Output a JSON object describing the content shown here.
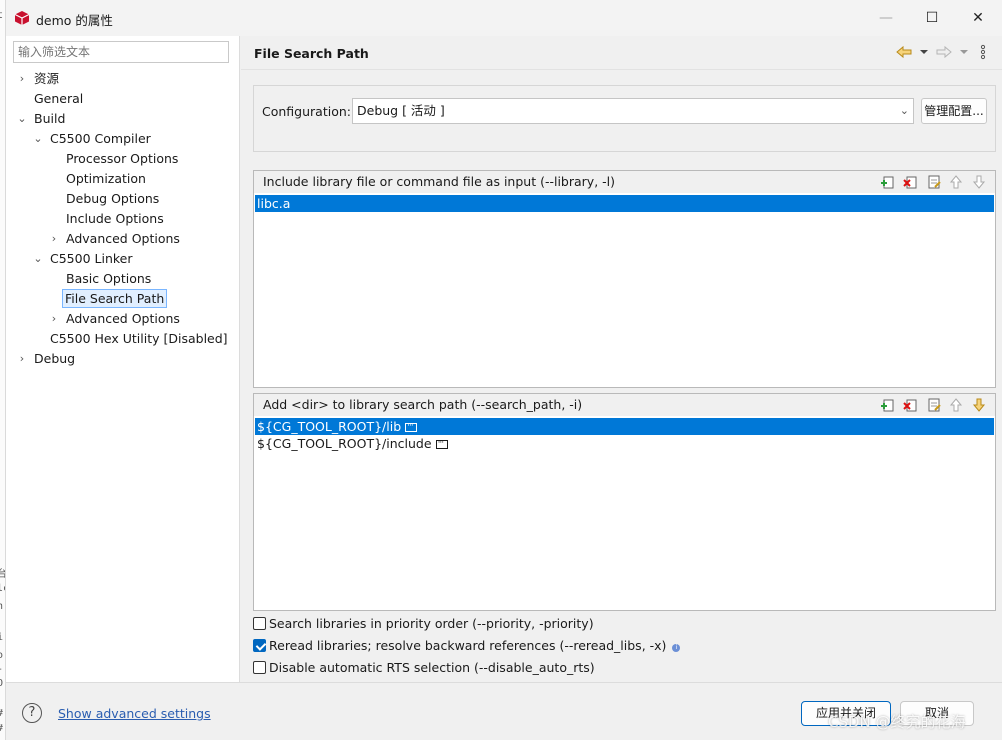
{
  "window": {
    "title": "demo 的属性",
    "minimize": "—",
    "maximize": "☐",
    "close": "✕",
    "background_strip": [
      "t",
      "台",
      "lc",
      "n",
      "i",
      "o",
      "-",
      "O",
      "#",
      "#"
    ]
  },
  "sidebar": {
    "filter_placeholder": "输入筛选文本",
    "items": [
      {
        "label": "资源",
        "expandable": true,
        "expanded": false
      },
      {
        "label": "General"
      },
      {
        "label": "Build",
        "expandable": true,
        "expanded": true
      },
      {
        "label": "C5500 Compiler",
        "expandable": true,
        "expanded": true
      },
      {
        "label": "Processor Options"
      },
      {
        "label": "Optimization"
      },
      {
        "label": "Debug Options"
      },
      {
        "label": "Include Options"
      },
      {
        "label": "Advanced Options",
        "expandable": true,
        "expanded": false
      },
      {
        "label": "C5500 Linker",
        "expandable": true,
        "expanded": true
      },
      {
        "label": "Basic Options"
      },
      {
        "label": "File Search Path",
        "selected": true
      },
      {
        "label": "Advanced Options",
        "expandable": true,
        "expanded": false
      },
      {
        "label": "C5500 Hex Utility  [Disabled]"
      },
      {
        "label": "Debug",
        "expandable": true,
        "expanded": false
      }
    ]
  },
  "header": {
    "title": "File Search Path",
    "icons": [
      "back-arrow-icon",
      "back-menu-icon",
      "forward-arrow-icon",
      "forward-menu-icon",
      "kebab-menu-icon"
    ]
  },
  "configuration": {
    "label": "Configuration:",
    "value": "Debug  [ 活动 ]",
    "manage_button": "管理配置..."
  },
  "library_list": {
    "title": "Include library file or command file as input (--library, -l)",
    "items": [
      {
        "text": "libc.a",
        "selected": true
      }
    ]
  },
  "search_path_list": {
    "title": "Add <dir> to library search path (--search_path, -i)",
    "items": [
      {
        "text": "${CG_TOOL_ROOT}/lib",
        "selected": true
      },
      {
        "text": "${CG_TOOL_ROOT}/include",
        "selected": false
      }
    ]
  },
  "options": [
    {
      "label": "Search libraries in priority order (--priority, -priority)",
      "checked": false
    },
    {
      "label": "Reread libraries; resolve backward references (--reread_libs, -x)",
      "checked": true
    },
    {
      "label": "Disable automatic RTS selection (--disable_auto_rts)",
      "checked": false
    }
  ],
  "footer": {
    "help_glyph": "?",
    "advanced_link": "Show advanced settings",
    "apply_close": "应用并关闭",
    "cancel": "取消",
    "watermark": "CSDN @终究的花海"
  },
  "colors": {
    "selection": "#0078d7",
    "link": "#2a5db0",
    "tree_selection_border": "#7ab6ff"
  }
}
